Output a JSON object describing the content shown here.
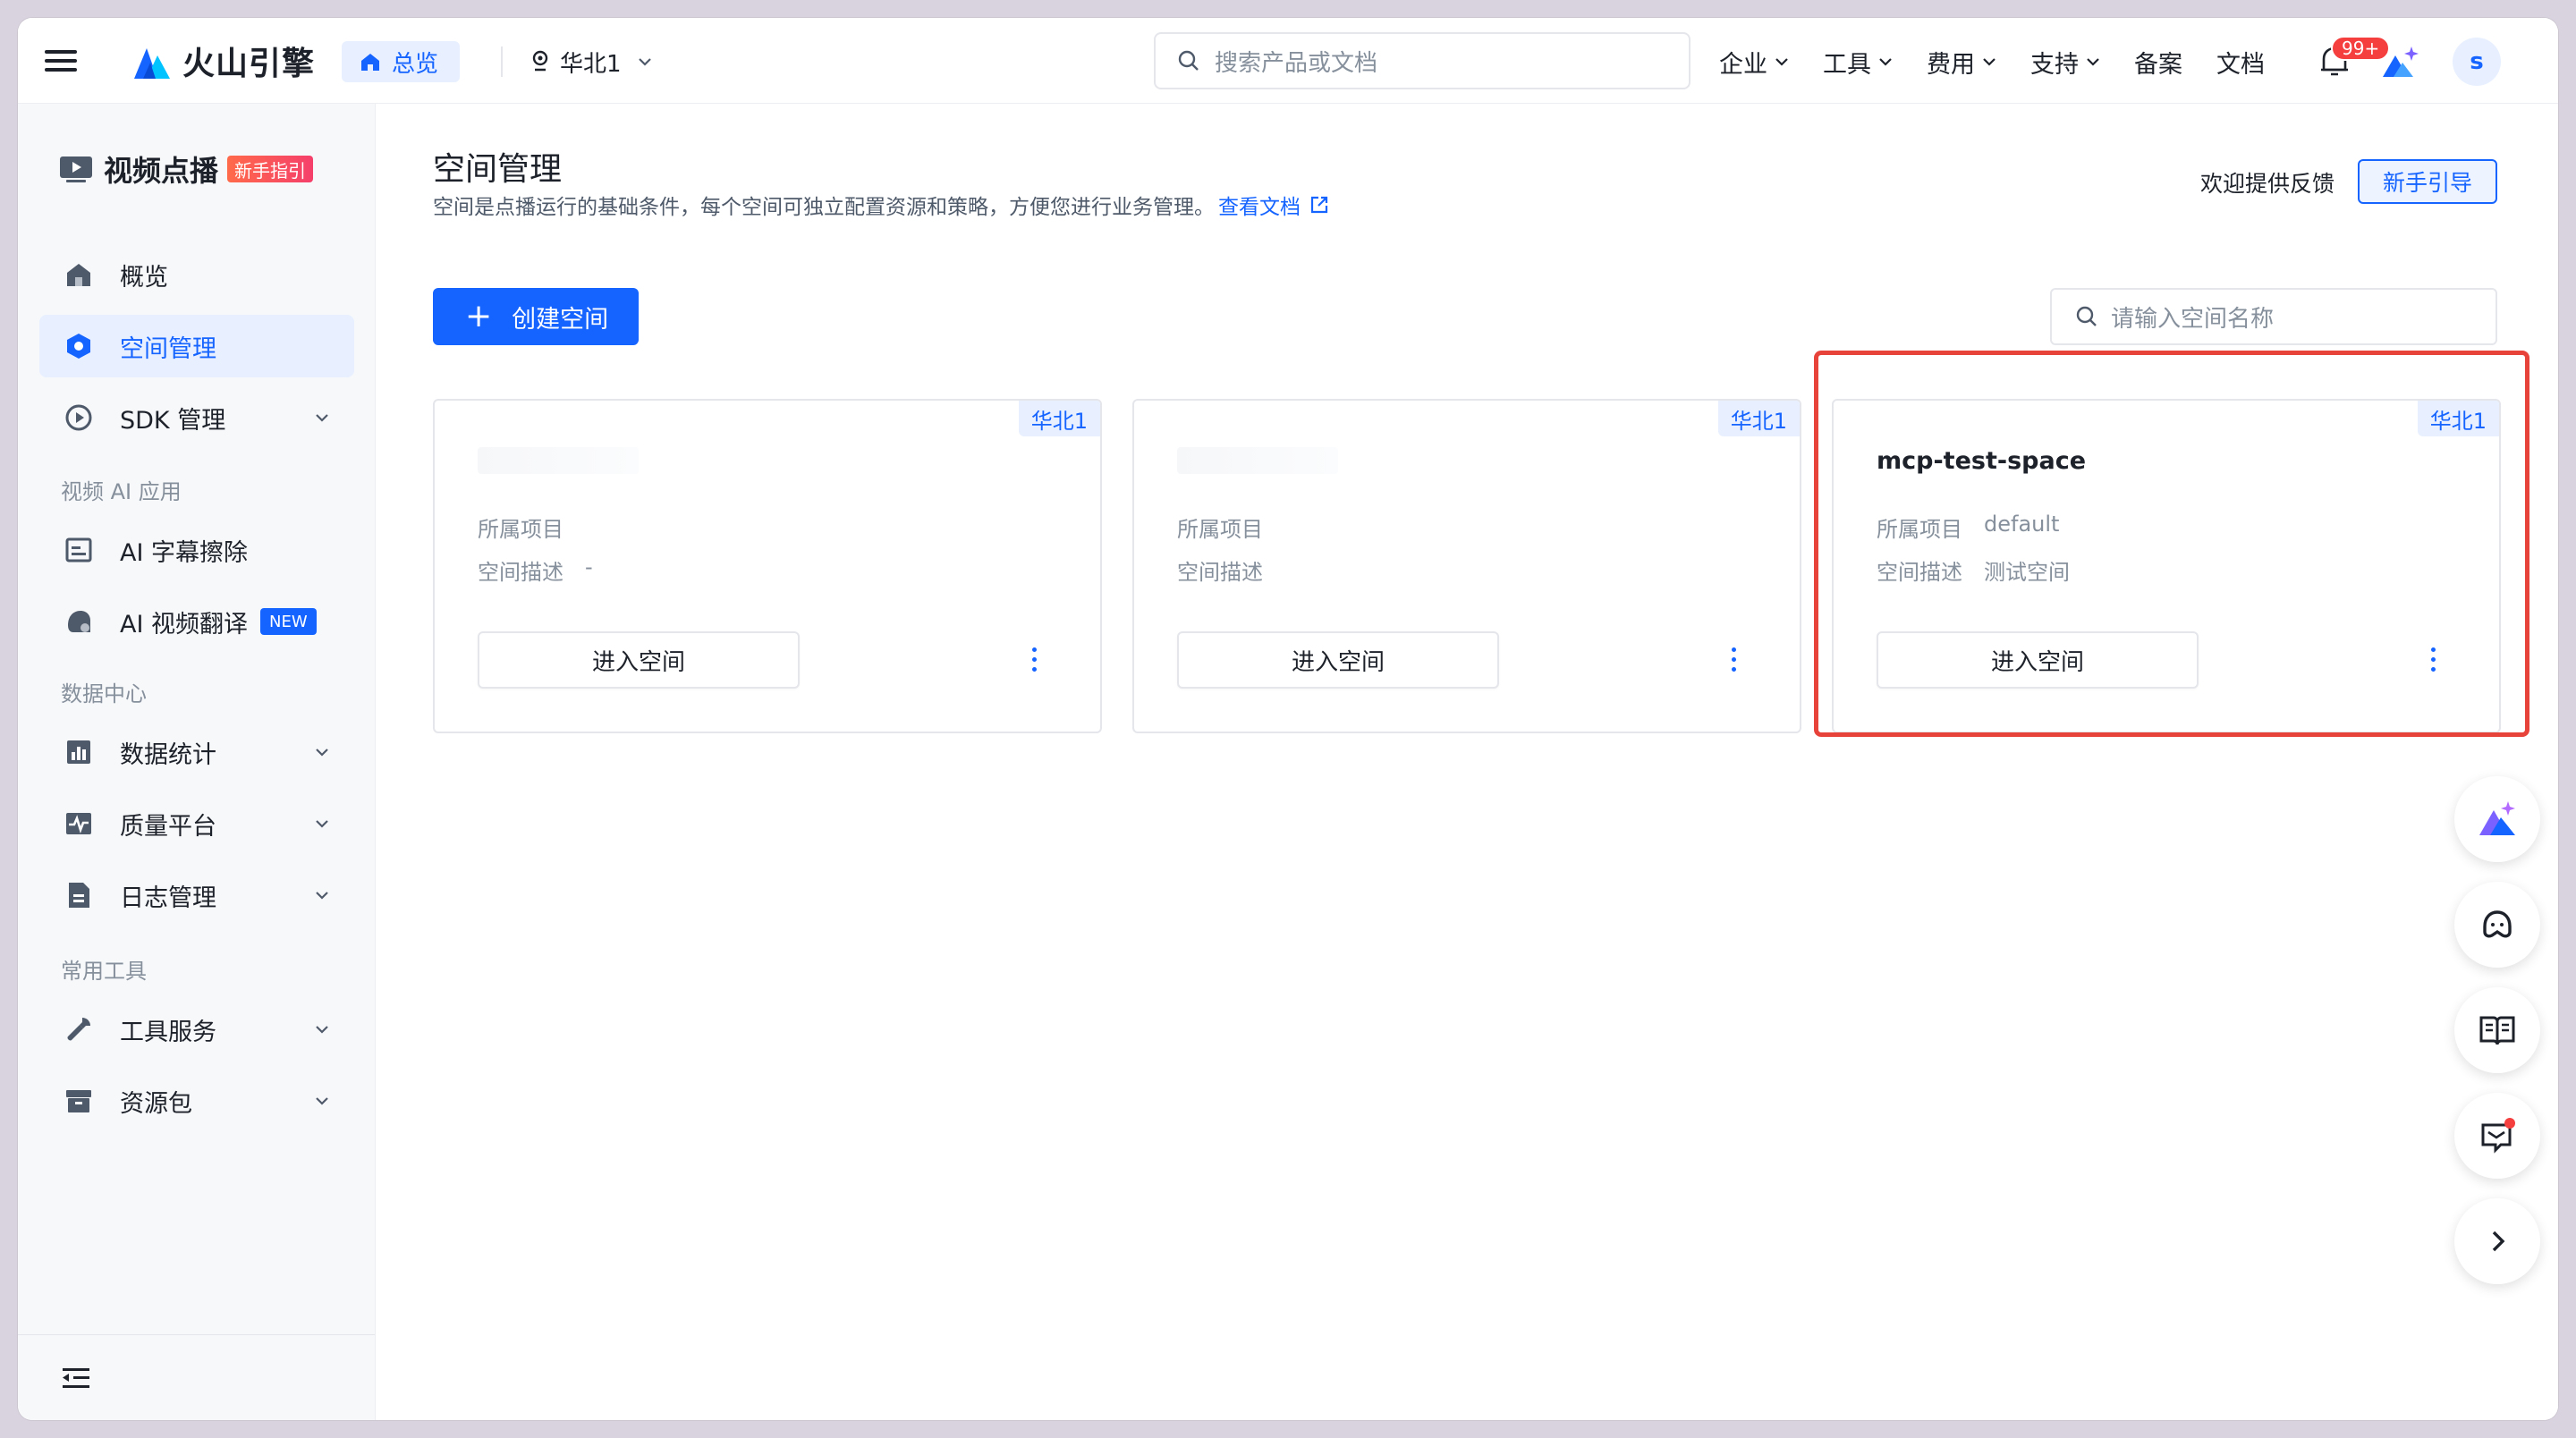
{
  "topbar": {
    "brand": "火山引擎",
    "home_chip": "总览",
    "region": "华北1",
    "search_placeholder": "搜索产品或文档",
    "nav": [
      {
        "label": "企业",
        "has_dropdown": true
      },
      {
        "label": "工具",
        "has_dropdown": true
      },
      {
        "label": "费用",
        "has_dropdown": true
      },
      {
        "label": "支持",
        "has_dropdown": true
      },
      {
        "label": "备案",
        "has_dropdown": false
      },
      {
        "label": "文档",
        "has_dropdown": false
      }
    ],
    "notification_badge": "99+",
    "avatar_initial": "s"
  },
  "sidebar": {
    "product": "视频点播",
    "product_badge": "新手指引",
    "items": [
      {
        "label": "概览",
        "icon": "home-icon",
        "active": false
      },
      {
        "label": "空间管理",
        "icon": "space-icon",
        "active": true
      },
      {
        "label": "SDK 管理",
        "icon": "sdk-icon",
        "active": false,
        "expandable": true
      }
    ],
    "group_ai": "视频 AI 应用",
    "ai_items": [
      {
        "label": "AI 字幕擦除",
        "icon": "subtitle-erase-icon"
      },
      {
        "label": "AI 视频翻译",
        "icon": "video-translate-icon",
        "badge": "NEW"
      }
    ],
    "group_data": "数据中心",
    "data_items": [
      {
        "label": "数据统计",
        "icon": "chart-icon"
      },
      {
        "label": "质量平台",
        "icon": "pulse-icon"
      },
      {
        "label": "日志管理",
        "icon": "log-icon"
      }
    ],
    "group_tools": "常用工具",
    "tool_items": [
      {
        "label": "工具服务",
        "icon": "wrench-icon"
      },
      {
        "label": "资源包",
        "icon": "package-icon"
      }
    ]
  },
  "main": {
    "title": "空间管理",
    "description": "空间是点播运行的基础条件，每个空间可独立配置资源和策略，方便您进行业务管理。",
    "doc_link": "查看文档",
    "feedback": "欢迎提供反馈",
    "guide_button": "新手引导",
    "create_button": "创建空间",
    "space_search_placeholder": "请输入空间名称",
    "cards": [
      {
        "name": "",
        "region": "华北1",
        "project_label": "所属项目",
        "project": "",
        "desc_label": "空间描述",
        "desc": "-",
        "enter": "进入空间"
      },
      {
        "name": "",
        "region": "华北1",
        "project_label": "所属项目",
        "project": "",
        "desc_label": "空间描述",
        "desc": "",
        "enter": "进入空间"
      },
      {
        "name": "mcp-test-space",
        "region": "华北1",
        "project_label": "所属项目",
        "project": "default",
        "desc_label": "空间描述",
        "desc": "测试空间",
        "enter": "进入空间"
      }
    ]
  },
  "colors": {
    "accent": "#1664ff",
    "highlight": "#e8433b",
    "badge_red": "#f53f3f"
  }
}
